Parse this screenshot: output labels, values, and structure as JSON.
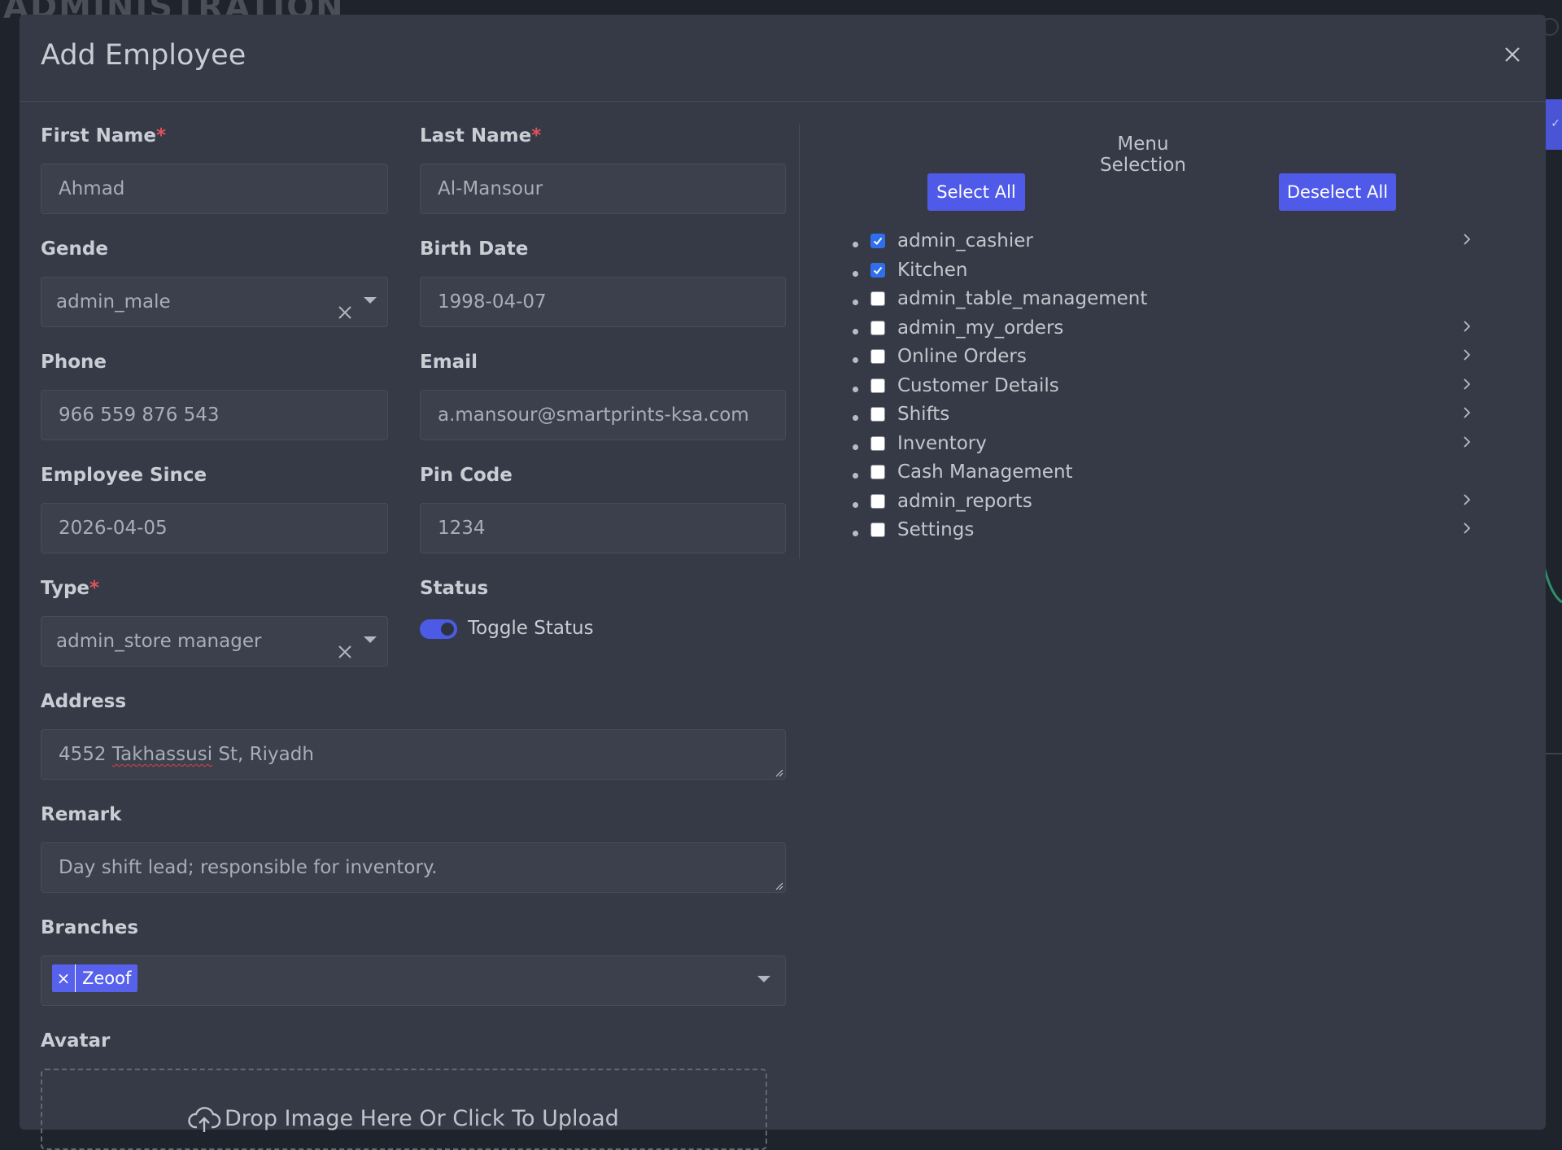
{
  "background": {
    "title": "ADMINISTRATION"
  },
  "modal": {
    "title": "Add Employee"
  },
  "form": {
    "first_name": {
      "label": "First Name",
      "required_mark": "*",
      "value": "Ahmad"
    },
    "last_name": {
      "label": "Last Name",
      "required_mark": "*",
      "value": "Al-Mansour"
    },
    "gender": {
      "label": "Gende",
      "value": "admin_male"
    },
    "birth_date": {
      "label": "Birth Date",
      "value": "1998-04-07"
    },
    "phone": {
      "label": "Phone",
      "value": "966 559 876 543"
    },
    "email": {
      "label": "Email",
      "value": "a.mansour@smartprints-ksa.com"
    },
    "employee_since": {
      "label": "Employee Since",
      "value": "2026-04-05"
    },
    "pin_code": {
      "label": "Pin Code",
      "value": "1234"
    },
    "type": {
      "label": "Type",
      "required_mark": "*",
      "value": "admin_store manager"
    },
    "status": {
      "label": "Status",
      "toggle_label": "Toggle Status",
      "on": true
    },
    "address": {
      "label": "Address",
      "value_prefix": "4552 ",
      "value_misspelled": "Takhassusi",
      "value_suffix": " St, Riyadh"
    },
    "remark": {
      "label": "Remark",
      "value": "Day shift lead; responsible for inventory."
    },
    "branches": {
      "label": "Branches",
      "tags": [
        "Zeoof"
      ],
      "tag_remove": "×"
    },
    "avatar": {
      "label": "Avatar",
      "dropzone_text": "Drop Image Here Or Click To Upload"
    }
  },
  "menu_selection": {
    "heading": "Menu Selection",
    "select_all": "Select All",
    "deselect_all": "Deselect All",
    "items": [
      {
        "label": "admin_cashier",
        "checked": true,
        "expandable": true
      },
      {
        "label": "Kitchen",
        "checked": true,
        "expandable": false
      },
      {
        "label": "admin_table_management",
        "checked": false,
        "expandable": false
      },
      {
        "label": "admin_my_orders",
        "checked": false,
        "expandable": true
      },
      {
        "label": "Online Orders",
        "checked": false,
        "expandable": true
      },
      {
        "label": "Customer Details",
        "checked": false,
        "expandable": true
      },
      {
        "label": "Shifts",
        "checked": false,
        "expandable": true
      },
      {
        "label": "Inventory",
        "checked": false,
        "expandable": true
      },
      {
        "label": "Cash Management",
        "checked": false,
        "expandable": false
      },
      {
        "label": "admin_reports",
        "checked": false,
        "expandable": true
      },
      {
        "label": "Settings",
        "checked": false,
        "expandable": true
      }
    ]
  },
  "colors": {
    "accent": "#4f5ae8",
    "checkbox_checked": "#2f6fed",
    "required": "#e0525a",
    "modal_bg": "#353a46"
  },
  "icons": {
    "close": "close-icon",
    "clear": "clear-icon",
    "caret": "caret-down-icon",
    "chevron": "chevron-right-icon",
    "upload": "upload-cloud-icon"
  }
}
